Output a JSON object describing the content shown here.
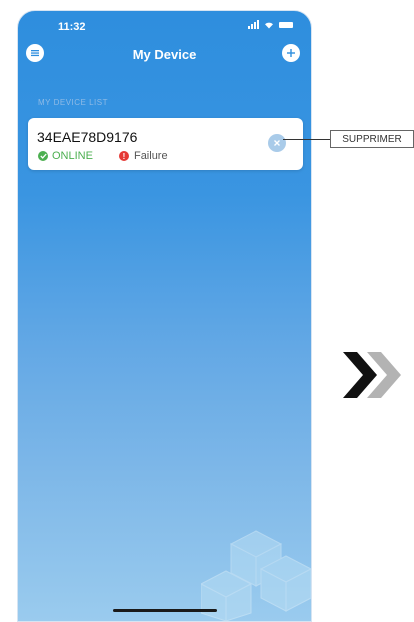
{
  "status_bar": {
    "time": "11:32"
  },
  "header": {
    "title": "My Device"
  },
  "device_list": {
    "label": "MY DEVICE LIST",
    "devices": [
      {
        "id": "34EAE78D9176",
        "status": "ONLINE",
        "alert": "Failure"
      }
    ]
  },
  "callout": {
    "label": "SUPPRIMER"
  },
  "colors": {
    "online": "#4caf50",
    "failure": "#e53935",
    "accent": "#2e8ede"
  }
}
